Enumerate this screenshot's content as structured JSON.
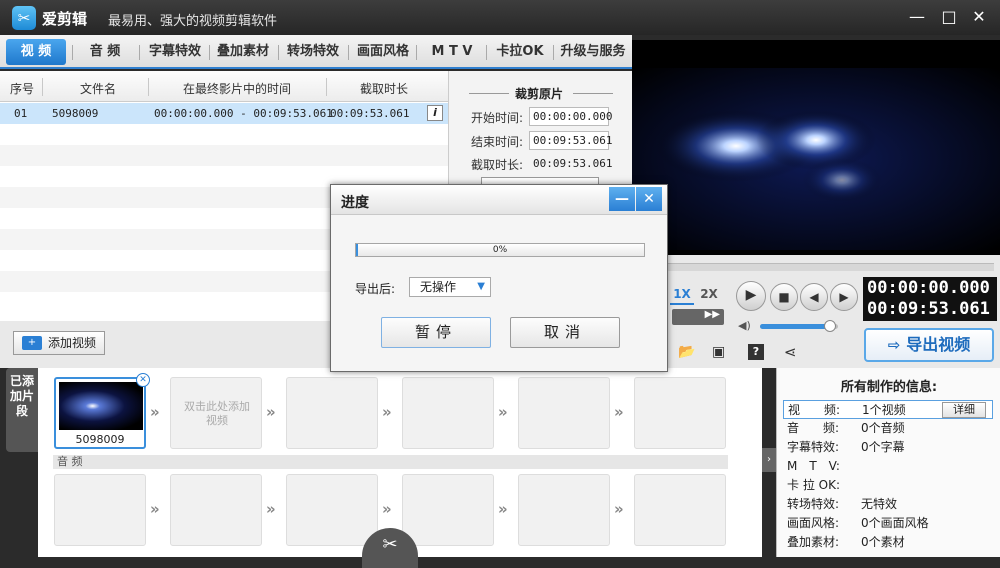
{
  "app": {
    "name": "爱剪辑",
    "slogan": "最易用、强大的视频剪辑软件"
  },
  "tabs": [
    "视 频",
    "音 频",
    "字幕特效",
    "叠加素材",
    "转场特效",
    "画面风格",
    "M T V",
    "卡拉OK",
    "升级与服务"
  ],
  "list": {
    "headers": [
      "序号",
      "文件名",
      "在最终影片中的时间",
      "截取时长"
    ],
    "rows": [
      {
        "index": "01",
        "name": "5098009",
        "span": "00:00:00.000 - 00:09:53.061",
        "duration": "00:09:53.061"
      }
    ]
  },
  "trim": {
    "title": "裁剪原片",
    "start_label": "开始时间:",
    "start_value": "00:00:00.000",
    "end_label": "结束时间:",
    "end_value": "00:09:53.061",
    "dur_label": "截取时长:",
    "dur_value": "00:09:53.061"
  },
  "player": {
    "speed_1x": "1X",
    "speed_2x": "2X",
    "time_current": "00:00:00.000",
    "time_total": "00:09:53.061",
    "volume": 0.9,
    "export_label": "导出视频"
  },
  "timeline": {
    "add_video_label": "添加视频",
    "side_label": "已添加片段",
    "clip_name": "5098009",
    "placeholder_text": "双击此处添加视频",
    "audio_label": "音 频"
  },
  "info": {
    "title": "所有制作的信息:",
    "detail_label": "详细",
    "rows": [
      {
        "key": "视　　频:",
        "value": "1个视频"
      },
      {
        "key": "音　　频:",
        "value": "0个音频"
      },
      {
        "key": "字幕特效:",
        "value": "0个字幕"
      },
      {
        "key": "M　T　V:",
        "value": ""
      },
      {
        "key": "卡 拉 OK:",
        "value": ""
      },
      {
        "key": "转场特效:",
        "value": "无特效"
      },
      {
        "key": "画面风格:",
        "value": "0个画面风格"
      },
      {
        "key": "叠加素材:",
        "value": "0个素材"
      }
    ]
  },
  "dialog": {
    "title": "进度",
    "progress_percent": 0,
    "progress_text": "0%",
    "after_label": "导出后:",
    "after_value": "无操作",
    "pause_label": "暂停",
    "cancel_label": "取消"
  }
}
